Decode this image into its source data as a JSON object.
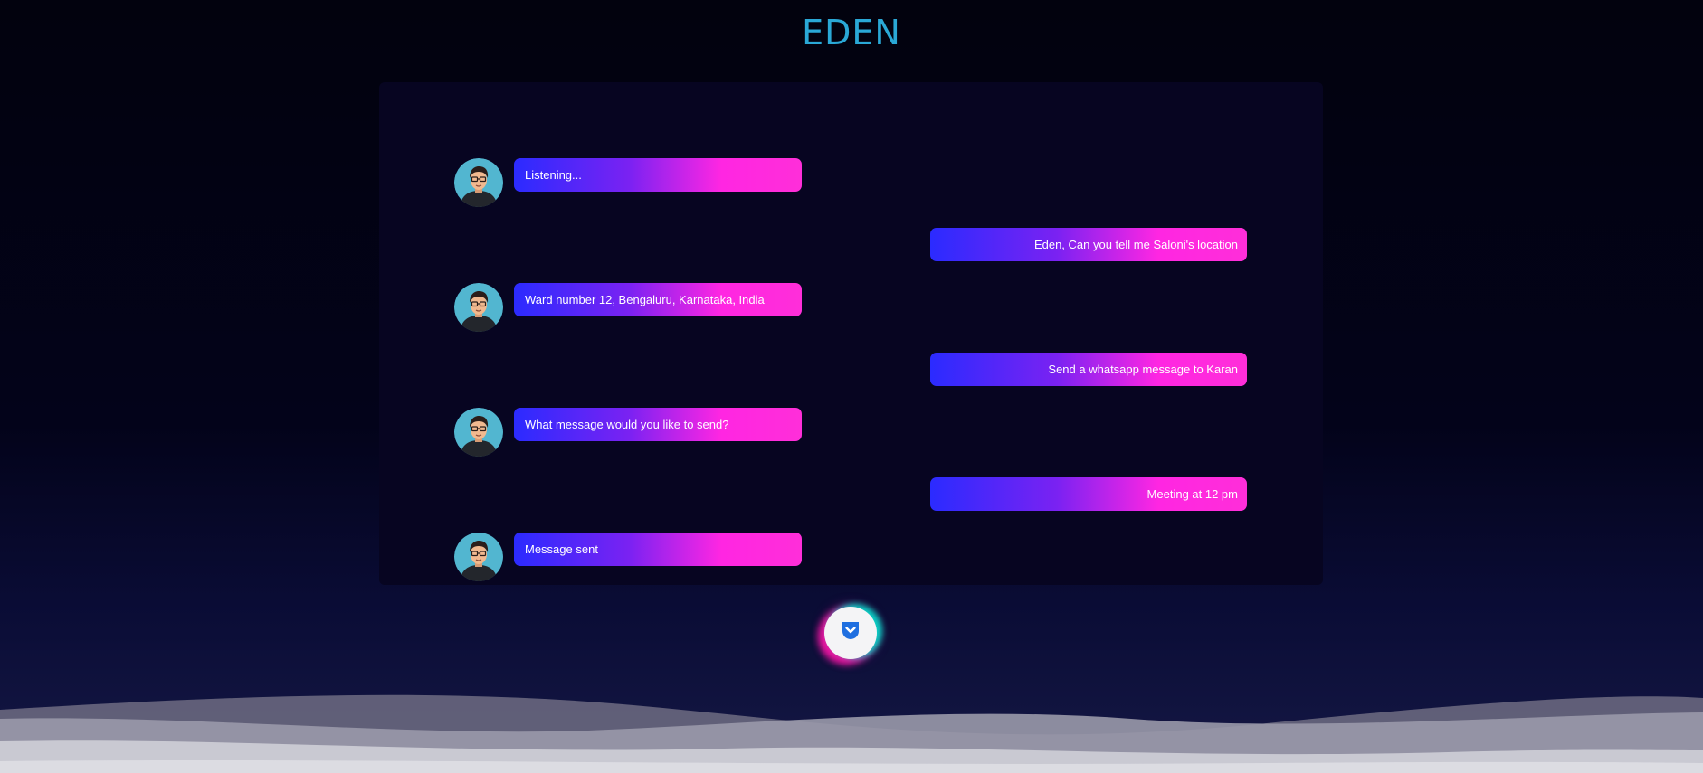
{
  "app": {
    "title": "EDEN"
  },
  "conversation": [
    {
      "sender": "assistant",
      "text": "Listening..."
    },
    {
      "sender": "user",
      "text": "Eden, Can you tell me Saloni's location"
    },
    {
      "sender": "assistant",
      "text": "Ward number 12, Bengaluru, Karnataka, India"
    },
    {
      "sender": "user",
      "text": "Send a whatsapp message to Karan"
    },
    {
      "sender": "assistant",
      "text": "What message would you like to send?"
    },
    {
      "sender": "user",
      "text": "Meeting at 12 pm"
    },
    {
      "sender": "assistant",
      "text": "Message sent"
    }
  ],
  "controls": {
    "mic_button_icon": "chevron-down-icon"
  },
  "theme": {
    "title_color": "#2aa8d6",
    "bubble_gradient_start": "#2b2bff",
    "bubble_gradient_end": "#ff2ed9",
    "panel_background": "#070521"
  }
}
